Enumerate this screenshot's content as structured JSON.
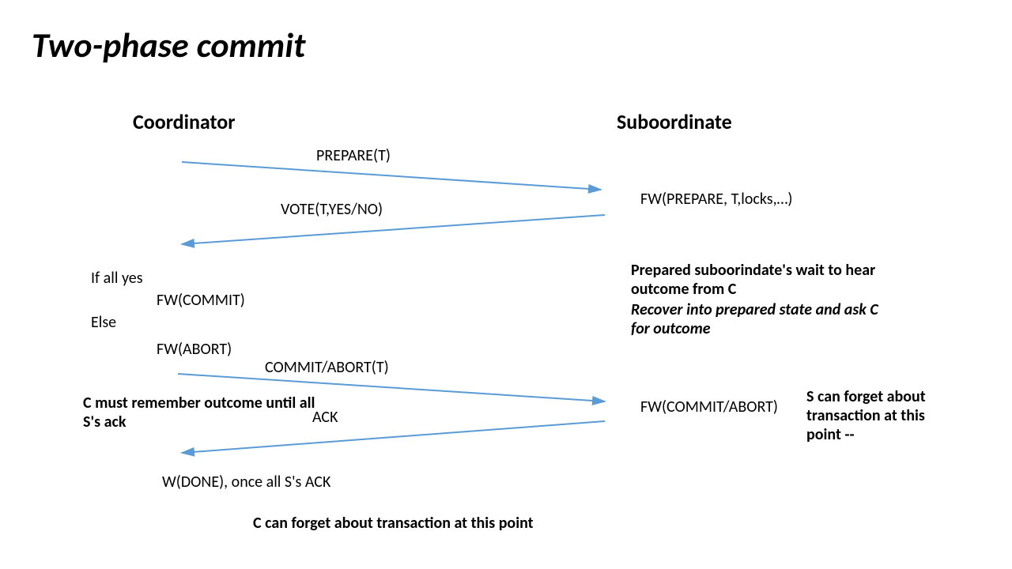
{
  "title": "Two-phase commit",
  "coordinator": "Coordinator",
  "subordinate": "Suboordinate",
  "msg_prepare": "PREPARE(T)",
  "msg_vote": "VOTE(T,YES/NO)",
  "msg_commit_abort": "COMMIT/ABORT(T)",
  "msg_ack": "ACK",
  "sub_fw_prepare": "FW(PREPARE, T,locks,…)",
  "sub_note_line1": "Prepared suboorindate's wait to hear outcome from C",
  "sub_note_line2": "Recover into prepared state and ask C for outcome",
  "sub_fw_commit": "FW(COMMIT/ABORT)",
  "sub_forget": "S can forget about transaction at this point --",
  "coord_if": "If all yes",
  "coord_fw_commit": "FW(COMMIT)",
  "coord_else": "Else",
  "coord_fw_abort": "FW(ABORT)",
  "coord_remember": "C must remember outcome until all S's ack",
  "coord_done": "W(DONE), once all S's ACK",
  "coord_forget": "C can forget about transaction at this point"
}
